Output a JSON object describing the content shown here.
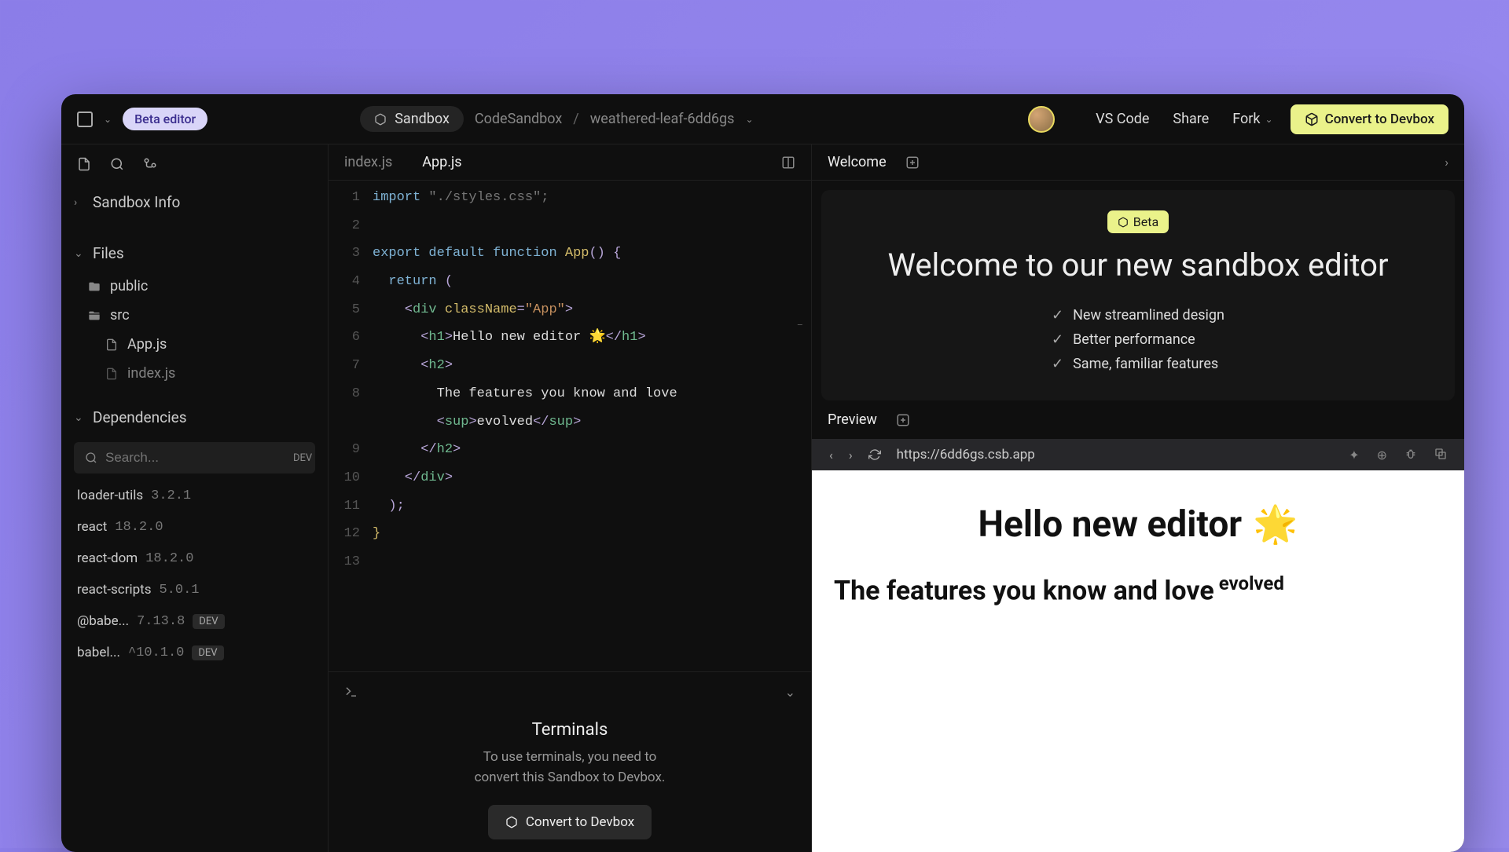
{
  "titlebar": {
    "beta_label": "Beta editor",
    "sandbox_label": "Sandbox",
    "org": "CodeSandbox",
    "project": "weathered-leaf-6dd6gs",
    "vscode": "VS Code",
    "share": "Share",
    "fork": "Fork",
    "convert": "Convert to Devbox"
  },
  "sidebar": {
    "info_label": "Sandbox Info",
    "files_label": "Files",
    "files": [
      "public",
      "src",
      "App.js",
      "index.js"
    ],
    "deps_label": "Dependencies",
    "search_placeholder": "Search...",
    "dev_tag": "DEV",
    "deps": [
      {
        "name": "loader-utils",
        "ver": "3.2.1"
      },
      {
        "name": "react",
        "ver": "18.2.0"
      },
      {
        "name": "react-dom",
        "ver": "18.2.0"
      },
      {
        "name": "react-scripts",
        "ver": "5.0.1"
      },
      {
        "name": "@babe...",
        "ver": "7.13.8",
        "dev": true
      },
      {
        "name": "babel...",
        "ver": "^10.1.0",
        "dev": true
      }
    ]
  },
  "editor": {
    "tabs": [
      "index.js",
      "App.js"
    ],
    "active_tab": 1,
    "lines": {
      "l1a": "import",
      "l1b": " \"./styles.css\";",
      "l3a": "export",
      "l3b": " default",
      "l3c": " function",
      "l3d": " App",
      "l3e": "()",
      "l3f": " {",
      "l4a": "  return",
      "l4b": " (",
      "l5a": "    <",
      "l5b": "div",
      "l5c": " className",
      "l5d": "=",
      "l5e": "\"App\"",
      "l5f": ">",
      "l6a": "      <",
      "l6b": "h1",
      "l6c": ">",
      "l6d": "Hello new editor 🌟",
      "l6e": "</",
      "l6f": "h1",
      "l6g": ">",
      "l7a": "      <",
      "l7b": "h2",
      "l7c": ">",
      "l8a": "        The features you know and love",
      "l8_5a": "        <",
      "l8_5b": "sup",
      "l8_5c": ">",
      "l8_5d": "evolved",
      "l8_5e": "</",
      "l8_5f": "sup",
      "l8_5g": ">",
      "l9a": "      </",
      "l9b": "h2",
      "l9c": ">",
      "l10a": "    </",
      "l10b": "div",
      "l10c": ">",
      "l11a": "  );",
      "l12a": "}"
    },
    "gutter": "1\n2\n3\n4\n5\n6\n7\n8\n\n9\n10\n11\n12\n13"
  },
  "terminals": {
    "title": "Terminals",
    "desc1": "To use terminals, you need to",
    "desc2": "convert this Sandbox to Devbox.",
    "btn": "Convert to Devbox"
  },
  "welcome": {
    "tab": "Welcome",
    "beta": "Beta",
    "heading": "Welcome to our new sandbox editor",
    "features": [
      "New streamlined design",
      "Better performance",
      "Same, familiar features"
    ]
  },
  "preview": {
    "tab": "Preview",
    "url": "https://6dd6gs.csb.app",
    "h1": "Hello new editor",
    "h2": "The features you know and love",
    "sup": "evolved"
  }
}
